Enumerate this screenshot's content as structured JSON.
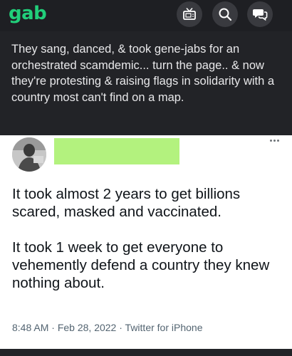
{
  "header": {
    "logo": "gab",
    "icons": [
      "tv-icon",
      "search-icon",
      "chat-icon"
    ]
  },
  "post": {
    "text": "They sang, danced, & took gene-jabs for an orchestrated scamdemic... turn the page.. & now they're protesting & raising flags in solidarity with a country most can't find on a map."
  },
  "tweet": {
    "lines": [
      "It took almost 2 years to get billions scared, masked and vaccinated.",
      "It took 1 week to get everyone to vehemently defend a country they knew nothing about."
    ],
    "time": "8:48 AM",
    "date": "Feb 28, 2022",
    "source": "Twitter for iPhone",
    "separator": "·"
  },
  "colors": {
    "brand": "#21cf7a",
    "background": "#222327",
    "redaction": "#b3f27e"
  }
}
